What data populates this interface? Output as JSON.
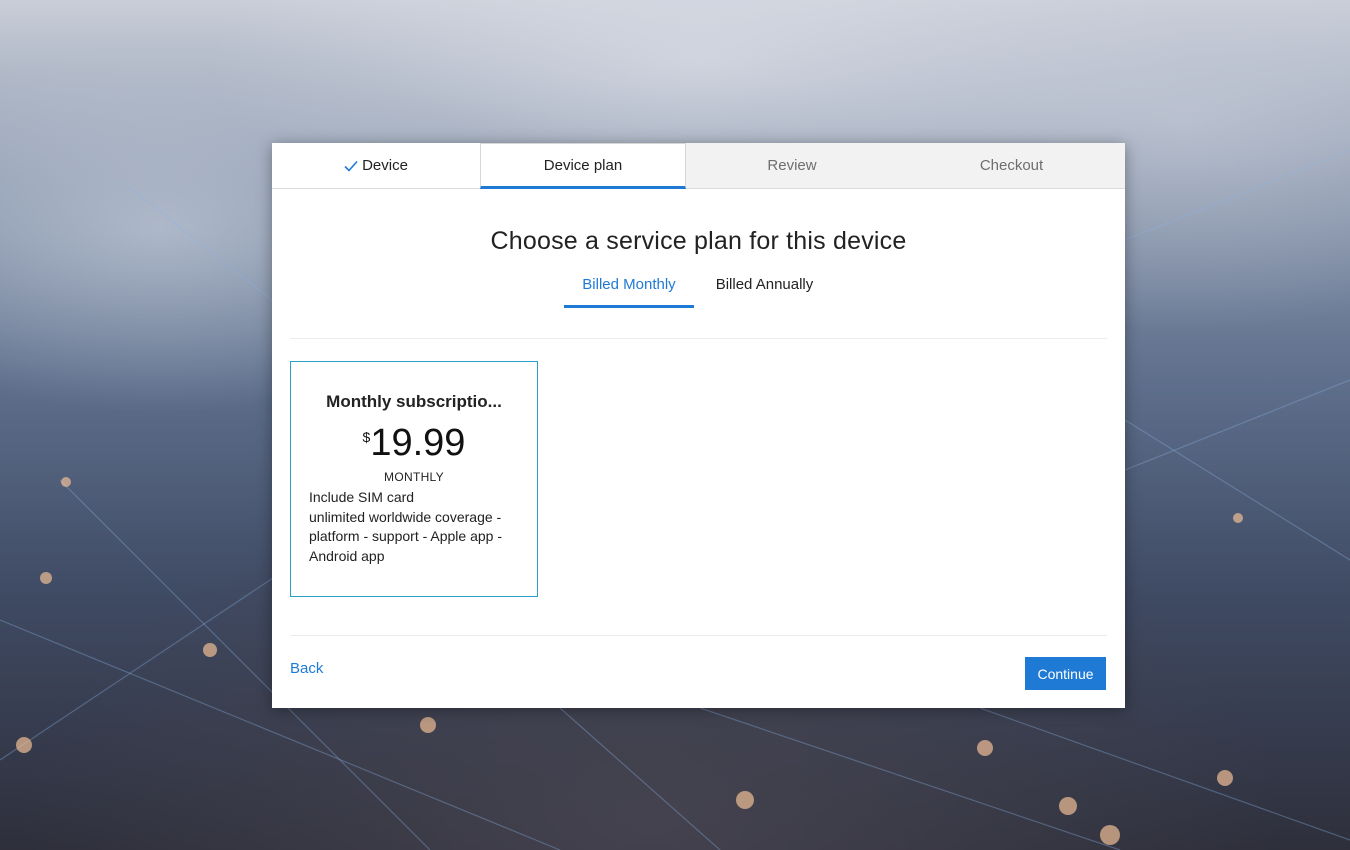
{
  "steps": [
    {
      "label": "Device",
      "state": "done"
    },
    {
      "label": "Device plan",
      "state": "active"
    },
    {
      "label": "Review",
      "state": "pending"
    },
    {
      "label": "Checkout",
      "state": "pending"
    }
  ],
  "title": "Choose a service plan for this device",
  "billing_tabs": [
    {
      "label": "Billed Monthly",
      "active": true
    },
    {
      "label": "Billed Annually",
      "active": false
    }
  ],
  "plan": {
    "name": "Monthly subscriptio...",
    "currency": "$",
    "amount": "19.99",
    "period": "MONTHLY",
    "features": "Include  SIM card\nunlimited  worldwide coverage -\nplatform - support - Apple app -\nAndroid app"
  },
  "footer": {
    "back_label": "Back",
    "continue_label": "Continue"
  },
  "colors": {
    "accent": "#1f7ad6",
    "card_border": "#2aa0c8"
  },
  "icons": {
    "step_done": "check-icon"
  }
}
